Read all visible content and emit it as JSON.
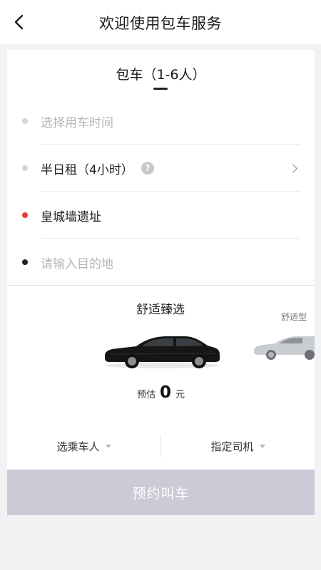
{
  "header": {
    "title": "欢迎使用包车服务",
    "back_icon": "chevron-left-icon"
  },
  "tab": {
    "label": "包车（1-6人）"
  },
  "form": {
    "time_placeholder": "选择用车时间",
    "duration": "半日租（4小时）",
    "help_symbol": "?",
    "origin": "皇城墙遗址",
    "destination_placeholder": "请输入目的地"
  },
  "car": {
    "selected_name": "舒适臻选",
    "next_name": "舒适型",
    "price_label": "预估",
    "price_value": "0",
    "price_unit": "元"
  },
  "options": {
    "passenger": "选乘车人",
    "driver": "指定司机"
  },
  "submit": {
    "label": "预约叫车"
  },
  "colors": {
    "origin_dot": "#e53b3b",
    "destination_dot": "#222222",
    "inactive_dot": "#d6d6d6",
    "button_disabled": "#cbcbd8"
  }
}
